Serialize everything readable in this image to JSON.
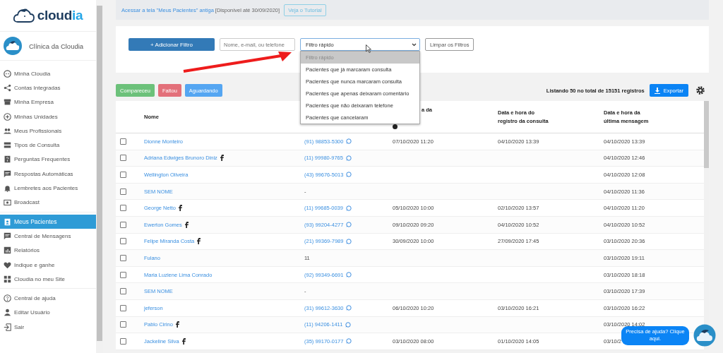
{
  "sidebar": {
    "brand": {
      "name": "cloud",
      "accent": "ia"
    },
    "clinic": "Clínica da Cloudia",
    "groups": [
      [
        {
          "label": "Minha Cloudia",
          "selected": false
        },
        {
          "label": "Contas Integradas",
          "selected": false
        },
        {
          "label": "Minha Empresa",
          "selected": false
        },
        {
          "label": "Minhas Unidades",
          "selected": false
        },
        {
          "label": "Meus Profissionais",
          "selected": false
        },
        {
          "label": "Tipos de Consulta",
          "selected": false
        },
        {
          "label": "Perguntas Frequentes",
          "selected": false
        },
        {
          "label": "Respostas Automáticas",
          "selected": false
        },
        {
          "label": "Lembretes aos Pacientes",
          "selected": false
        },
        {
          "label": "Broadcast",
          "selected": false
        }
      ],
      [
        {
          "label": "Meus Pacientes",
          "selected": true
        },
        {
          "label": "Central de Mensagens",
          "selected": false
        },
        {
          "label": "Relatórios",
          "selected": false
        },
        {
          "label": "Indique e ganhe",
          "selected": false
        },
        {
          "label": "Cloudia no meu Site",
          "selected": false
        }
      ],
      [
        {
          "label": "Central de ajuda",
          "selected": false
        },
        {
          "label": "Editar Usuário",
          "selected": false
        },
        {
          "label": "Sair",
          "selected": false
        }
      ]
    ]
  },
  "notice": {
    "link": "Acessar a tela \"Meus Pacientes\" antiga",
    "note": "[Disponível até 30/09/2020]",
    "button": "Veja o Tutorial"
  },
  "filters": {
    "add_button": "+ Adicionar Filtro",
    "search": {
      "placeholder": "Nome, e-mail, ou telefone"
    },
    "quick_filter": {
      "value": "Filtro rápido",
      "expanded": true,
      "options": [
        {
          "label": "Filtro rápido",
          "selected": true
        },
        {
          "label": "Pacientes que já marcaram consulta",
          "selected": false
        },
        {
          "label": "Pacientes que nunca marcaram consulta",
          "selected": false
        },
        {
          "label": "Pacientes que apenas deixaram comentário",
          "selected": false
        },
        {
          "label": "Pacientes que não deixaram telefone",
          "selected": false
        },
        {
          "label": "Pacientes que cancelaram",
          "selected": false
        }
      ]
    },
    "clear_button": "Limpar os Filtros"
  },
  "status_buttons": [
    {
      "label": "Compareceu",
      "color": "#6cc17a"
    },
    {
      "label": "Faltou",
      "color": "#e3707a"
    },
    {
      "label": "Aguardando",
      "color": "#55a6f2"
    }
  ],
  "summary": "Listando 50 no total de 15151 registros",
  "export_button": "Exportar",
  "table": {
    "columns": [
      "Nome",
      "a da",
      "Data e hora do\nregistro da consulta",
      "Data e hora da\núltima mensagem"
    ],
    "rows": [
      {
        "checked": false,
        "name": "Dionne Monteiro",
        "facebook": false,
        "phone": "(91) 98853-5300",
        "whatsapp": true,
        "appointment": "07/10/2020 11:20",
        "registered": "04/10/2020 13:39",
        "last_message": "04/10/2020 13:39"
      },
      {
        "checked": false,
        "name": "Adriana Edwiges Brunoro Diniz",
        "facebook": true,
        "phone": "(11) 99980-9765",
        "whatsapp": true,
        "appointment": "",
        "registered": "",
        "last_message": "04/10/2020 12:46"
      },
      {
        "checked": false,
        "name": "Wellington Oliveira",
        "facebook": false,
        "phone": "(43) 99676-5013",
        "whatsapp": true,
        "appointment": "",
        "registered": "",
        "last_message": "04/10/2020 12:08"
      },
      {
        "checked": false,
        "name": "SEM NOME",
        "facebook": false,
        "phone": "-",
        "whatsapp": false,
        "appointment": "",
        "registered": "",
        "last_message": "04/10/2020 11:36"
      },
      {
        "checked": false,
        "name": "George Netto",
        "facebook": true,
        "phone": "(11) 99685-0039",
        "whatsapp": true,
        "appointment": "05/10/2020 10:00",
        "registered": "02/10/2020 13:57",
        "last_message": "04/10/2020 11:20"
      },
      {
        "checked": false,
        "name": "Ewerton Gomes",
        "facebook": true,
        "phone": "(93) 99204-4277",
        "whatsapp": true,
        "appointment": "09/10/2020 09:20",
        "registered": "04/10/2020 10:52",
        "last_message": "04/10/2020 10:52"
      },
      {
        "checked": false,
        "name": "Felipe Miranda Costa",
        "facebook": true,
        "phone": "(21) 99369-7989",
        "whatsapp": true,
        "appointment": "30/09/2020 10:00",
        "registered": "27/09/2020 17:45",
        "last_message": "03/10/2020 20:36"
      },
      {
        "checked": false,
        "name": "Fulano",
        "facebook": false,
        "phone": "11",
        "whatsapp": false,
        "appointment": "",
        "registered": "",
        "last_message": "03/10/2020 19:11"
      },
      {
        "checked": false,
        "name": "Maria Luziene Lima Conrado",
        "facebook": false,
        "phone": "(92) 99349-6691",
        "whatsapp": true,
        "appointment": "",
        "registered": "",
        "last_message": "03/10/2020 18:18"
      },
      {
        "checked": false,
        "name": "SEM NOME",
        "facebook": false,
        "phone": "-",
        "whatsapp": false,
        "appointment": "",
        "registered": "",
        "last_message": "03/10/2020 17:39"
      },
      {
        "checked": false,
        "name": "jeferson",
        "facebook": false,
        "phone": "(31) 99612-3630",
        "whatsapp": true,
        "appointment": "06/10/2020 10:20",
        "registered": "03/10/2020 16:21",
        "last_message": "03/10/2020 16:22"
      },
      {
        "checked": false,
        "name": "Pablo Cirino",
        "facebook": true,
        "phone": "(11) 94206-1411",
        "whatsapp": true,
        "appointment": "",
        "registered": "",
        "last_message": "03/10/2020 14:02"
      },
      {
        "checked": false,
        "name": "Jackeline Silva",
        "facebook": true,
        "phone": "(35) 99170-0177",
        "whatsapp": true,
        "appointment": "03/10/2020 08:00",
        "registered": "01/10/2020 14:05",
        "last_message": "03/10/2"
      }
    ]
  },
  "help_bubble": "Precisa de ajuda? Clique aqui."
}
